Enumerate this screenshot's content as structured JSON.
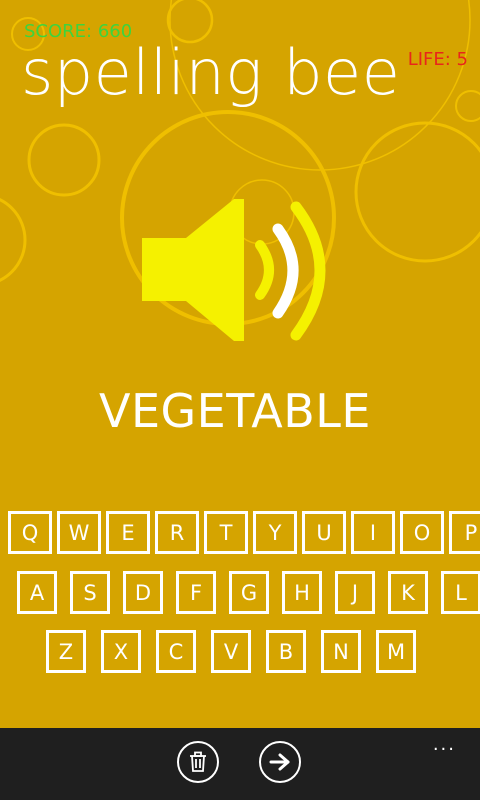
{
  "header": {
    "score_text": "SCORE: 660",
    "life_text": "LIFE: 5",
    "title": "spelling bee"
  },
  "game": {
    "current_word": "VEGETABLE",
    "speaker_icon": "speaker-volume-icon"
  },
  "keyboard": {
    "rows": [
      [
        "Q",
        "W",
        "E",
        "R",
        "T",
        "Y",
        "U",
        "I",
        "O",
        "P"
      ],
      [
        "A",
        "S",
        "D",
        "F",
        "G",
        "H",
        "J",
        "K",
        "L"
      ],
      [
        "Z",
        "X",
        "C",
        "V",
        "B",
        "N",
        "M"
      ]
    ]
  },
  "appbar": {
    "delete_icon": "trash-icon",
    "next_icon": "arrow-right-icon",
    "more_label": "..."
  },
  "colors": {
    "background": "#D5A400",
    "speaker": "#F5F100",
    "score": "#3DD43D",
    "life": "#E8261A",
    "appbar": "#1F1F1F"
  }
}
